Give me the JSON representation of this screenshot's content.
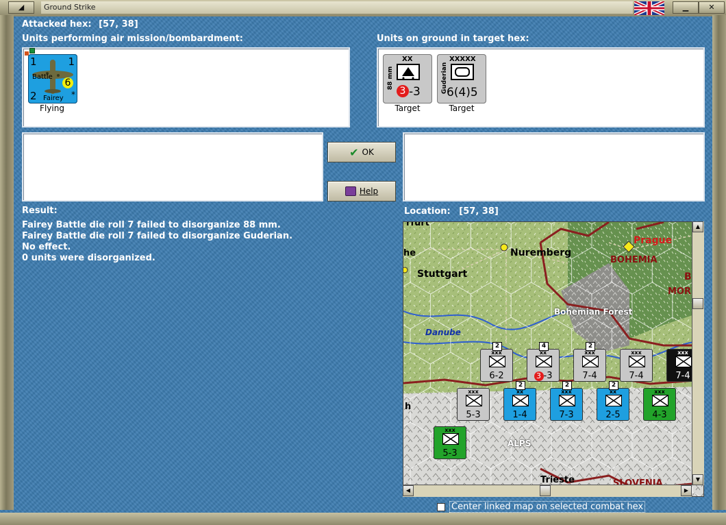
{
  "window": {
    "title": "Ground Strike",
    "flag_icon": "uk-flag-icon"
  },
  "attacked_hex": {
    "label": "Attacked hex:",
    "value": "[57, 38]"
  },
  "air_units": {
    "heading": "Units performing air mission/bombardment:",
    "items": [
      {
        "top_left": "1",
        "top_right": "1",
        "bottom_left": "2",
        "name_line1": "Battle",
        "name_line2": "Fairey",
        "strength": "6",
        "star": "*",
        "status": "Flying",
        "color": "#1e9fe0"
      }
    ]
  },
  "ground_units": {
    "heading": "Units on ground in target hex:",
    "items": [
      {
        "size": "XX",
        "side_label": "88 mm",
        "attack": "3",
        "sep": "-",
        "defense": "3",
        "status": "Target",
        "color": "#c8c8c8"
      },
      {
        "size": "XXXXX",
        "side_label": "Guderian",
        "values": "6(4)5",
        "status": "Target",
        "color": "#c8c8c8"
      }
    ]
  },
  "buttons": {
    "ok": "OK",
    "help": "Help"
  },
  "result": {
    "heading": "Result:",
    "lines": [
      "Fairey Battle die roll 7 failed to disorganize 88 mm.",
      "Fairey Battle die roll 7 failed to disorganize Guderian.",
      "No effect.",
      "0 units were disorganized."
    ]
  },
  "location": {
    "label": "Location:",
    "value": "[57, 38]"
  },
  "map": {
    "places": {
      "erfurt": "rfurt",
      "the": "he",
      "nuremberg": "Nuremberg",
      "stuttgart": "Stuttgart",
      "prague": "Prague",
      "bohemia": "BOHEMIA",
      "b": "B",
      "mor": "MOR",
      "bohemian_forest": "Bohemian Forest",
      "danube": "Danube",
      "h": "h",
      "alps": "ALPS",
      "trieste": "Trieste",
      "slovenia": "SLOVENIA"
    },
    "counters": [
      {
        "value": "6-2",
        "size": "xxx",
        "stack": "2",
        "color": "#c8c8c8"
      },
      {
        "value": "3",
        "value2": "-3",
        "size": "xx",
        "stack": "4",
        "color": "#c8c8c8"
      },
      {
        "value": "7-4",
        "size": "xxx",
        "stack": "2",
        "color": "#c8c8c8"
      },
      {
        "value": "7-4",
        "size": "xxx",
        "stack": "",
        "color": "#c8c8c8"
      },
      {
        "value": "7-4",
        "size": "xxx",
        "stack": "",
        "color": "#111111"
      },
      {
        "value": "5-3",
        "size": "xxx",
        "stack": "",
        "color": "#c8c8c8"
      },
      {
        "value": "1-4",
        "size": "xx",
        "stack": "2",
        "color": "#1e9fe0"
      },
      {
        "value": "7-3",
        "size": "xxx",
        "stack": "2",
        "color": "#1e9fe0"
      },
      {
        "value": "2-5",
        "size": "xx",
        "stack": "2",
        "color": "#1e9fe0"
      },
      {
        "value": "4-3",
        "size": "xxx",
        "stack": "",
        "color": "#22a32a"
      },
      {
        "value": "5-3",
        "size": "xxx",
        "stack": "",
        "color": "#22a32a"
      }
    ]
  },
  "center_checkbox": {
    "label": "Center linked map on selected combat hex",
    "checked": false
  }
}
